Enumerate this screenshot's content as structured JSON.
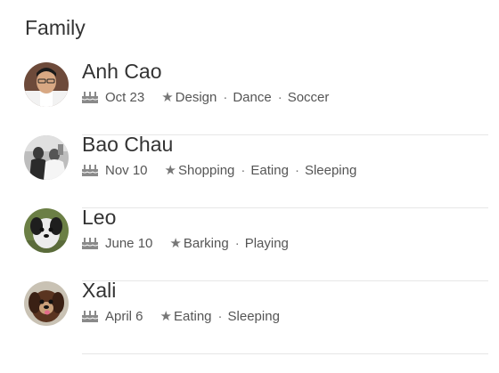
{
  "section": {
    "title": "Family"
  },
  "members": [
    {
      "name": "Anh Cao",
      "birthday": "Oct 23",
      "interests": [
        "Design",
        "Dance",
        "Soccer"
      ]
    },
    {
      "name": "Bao Chau",
      "birthday": "Nov 10",
      "interests": [
        "Shopping",
        "Eating",
        "Sleeping"
      ]
    },
    {
      "name": "Leo",
      "birthday": "June 10",
      "interests": [
        "Barking",
        "Playing"
      ]
    },
    {
      "name": "Xali",
      "birthday": "April 6",
      "interests": [
        "Eating",
        "Sleeping"
      ]
    }
  ],
  "icons": {
    "birthday": "cake-icon",
    "interests": "star-icon"
  },
  "glyphs": {
    "star": "★",
    "separator": "·"
  }
}
